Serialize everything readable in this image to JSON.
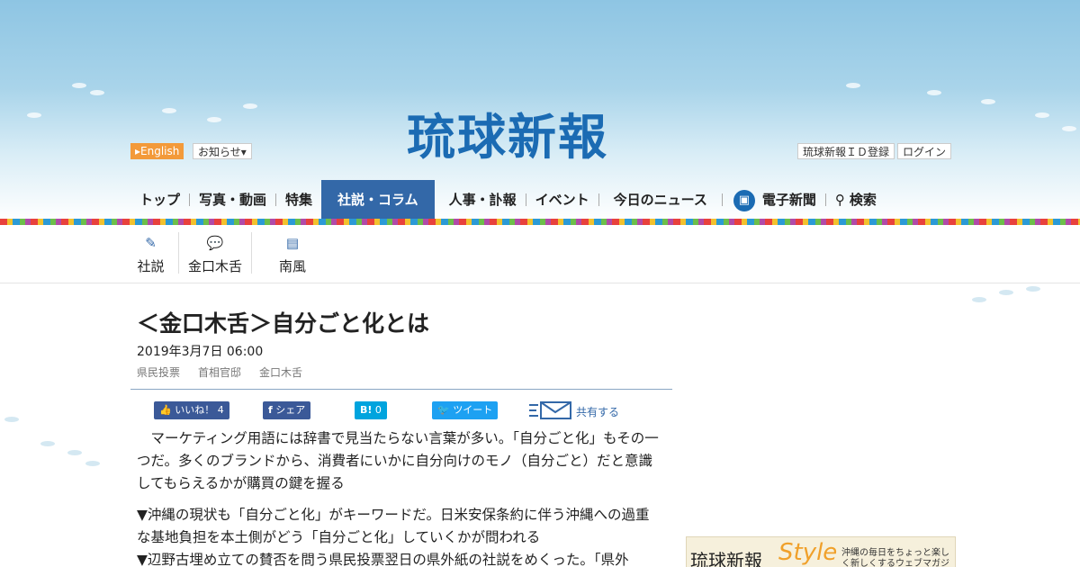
{
  "header": {
    "logo": "琉球新報",
    "english_label": "▸English",
    "notice_label": "お知らせ▾",
    "id_register_label": "琉球新報ＩＤ登録",
    "login_label": "ログイン"
  },
  "nav": {
    "items": [
      "トップ",
      "写真・動画",
      "特集",
      "社説・コラム",
      "人事・訃報",
      "イベント",
      "今日のニュース",
      "電子新聞",
      "検索"
    ],
    "active": "社説・コラム"
  },
  "subnav": {
    "items": [
      {
        "label": "社説",
        "icon": "pen-icon"
      },
      {
        "label": "金口木舌",
        "icon": "chat-icon"
      },
      {
        "label": "南風",
        "icon": "comment-icon"
      }
    ]
  },
  "article": {
    "title": "＜金口木舌＞自分ごと化とは",
    "date": "2019年3月7日 06:00",
    "tags": [
      "県民投票",
      "首相官邸",
      "金口木舌"
    ],
    "share": {
      "like": "いいね！",
      "like_count": "4",
      "fb_share": "シェア",
      "hatena": "B!",
      "hatena_count": "0",
      "tweet": "ツイート",
      "share_label": "共有する"
    },
    "paragraphs": [
      "　マーケティング用語には辞書で見当たらない言葉が多い。「自分ごと化」もその一つだ。多くのブランドから、消費者にいかに自分向けのモノ（自分ごと）だと意識してもらえるかが購買の鍵を握る",
      "▼沖縄の現状も「自分ごと化」がキーワードだ。日米安保条約に伴う沖縄への過重な基地負担を本土側がどう「自分ごと化」していくかが問われる",
      "▼辺野古埋め立ての賛否を問う県民投票翌日の県外紙の社説をめくった。「県外"
    ]
  },
  "ad": {
    "title": "琉球新報",
    "style_word": "Style",
    "subtitle": "沖縄の毎日をちょっと楽しく新しくするウェブマガジン"
  },
  "colors": {
    "brand_blue": "#1b6bb3",
    "nav_active": "#3368a8",
    "english_orange": "#f39a3a",
    "facebook": "#3b5998",
    "hatena": "#00a4de",
    "twitter": "#1da1f2"
  }
}
